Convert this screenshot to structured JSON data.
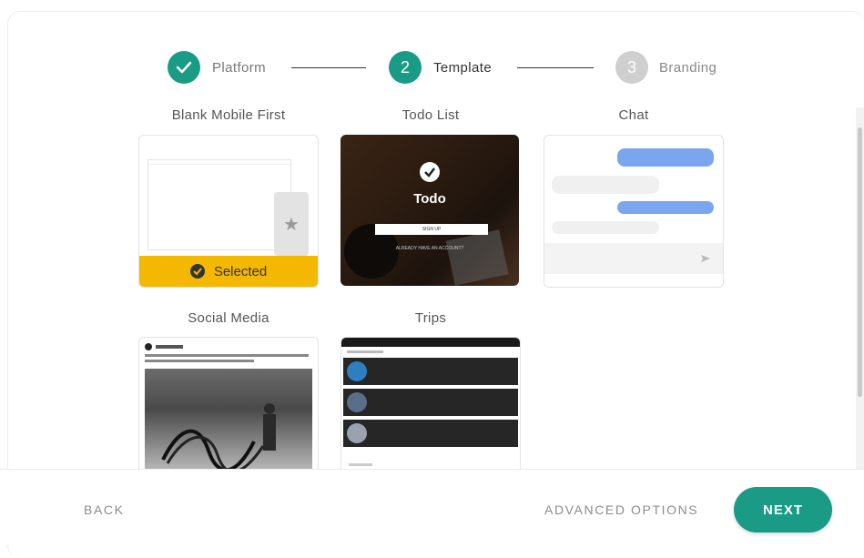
{
  "stepper": {
    "steps": [
      {
        "number": "✓",
        "label": "Platform"
      },
      {
        "number": "2",
        "label": "Template"
      },
      {
        "number": "3",
        "label": "Branding"
      }
    ]
  },
  "templates": [
    {
      "title": "Blank Mobile First",
      "badge": "Selected"
    },
    {
      "title": "Todo List",
      "preview_title": "Todo",
      "signup": "SIGN UP",
      "login": "ALREADY HAVE AN ACCOUNT?"
    },
    {
      "title": "Chat"
    },
    {
      "title": "Social Media"
    },
    {
      "title": "Trips"
    }
  ],
  "footer": {
    "back": "BACK",
    "advanced": "ADVANCED OPTIONS",
    "next": "NEXT"
  },
  "colors": {
    "accent": "#1a9b86",
    "selected": "#f5b800",
    "inactive_step": "#cfcfcf"
  }
}
